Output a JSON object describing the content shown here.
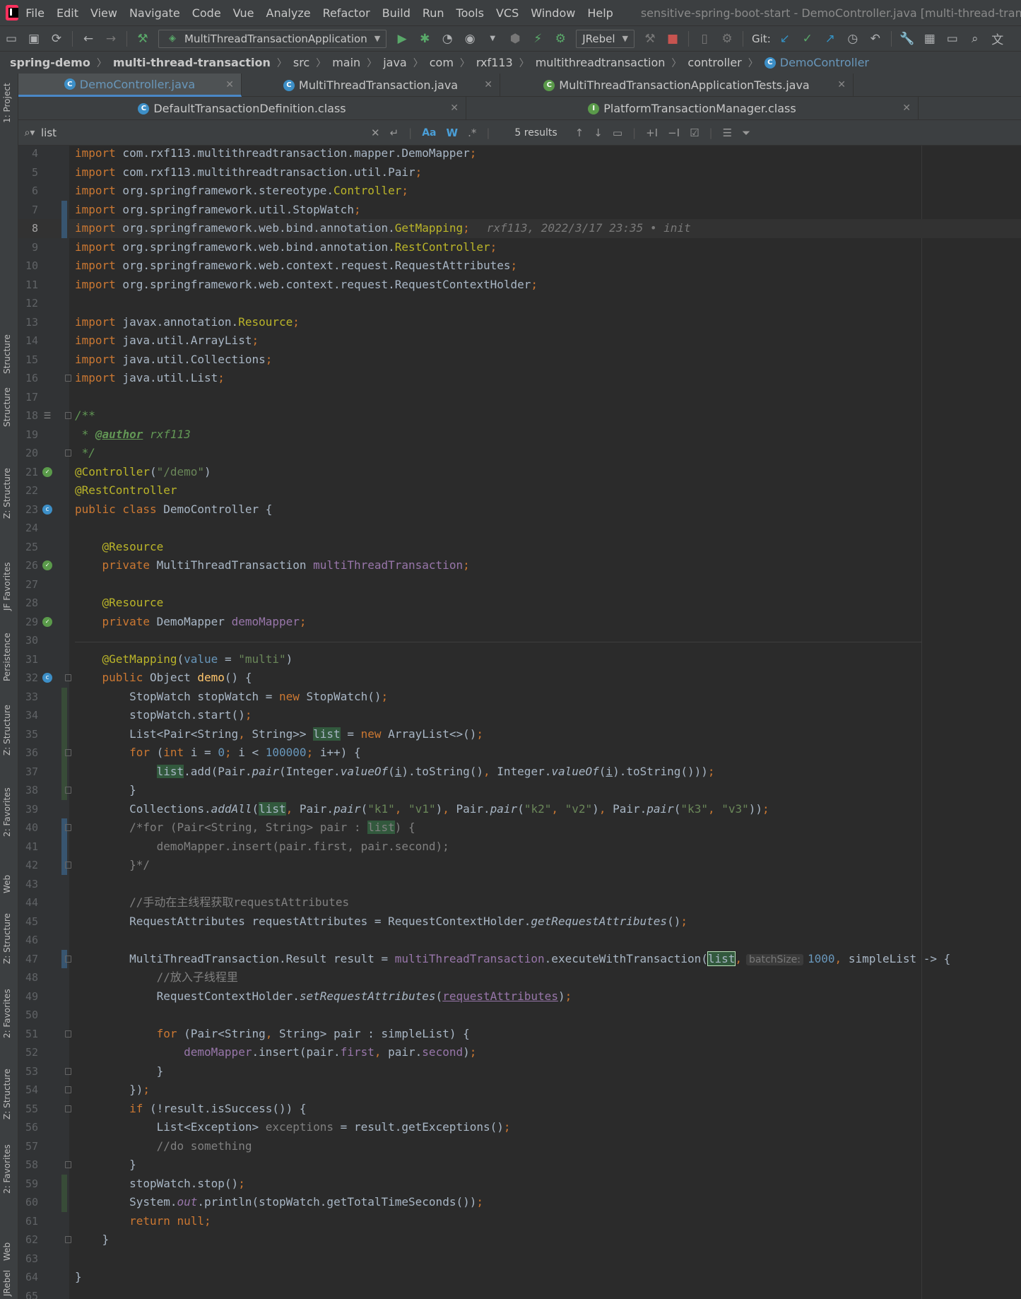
{
  "menu": {
    "items": [
      "File",
      "Edit",
      "View",
      "Navigate",
      "Code",
      "Vue",
      "Analyze",
      "Refactor",
      "Build",
      "Run",
      "Tools",
      "VCS",
      "Window",
      "Help"
    ],
    "window_title": "sensitive-spring-boot-start - DemoController.java [multi-thread-transaction] - Inte"
  },
  "toolbar": {
    "run_config": "MultiThreadTransactionApplication",
    "jrebel": "JRebel",
    "git_label": "Git:"
  },
  "breadcrumb": [
    "spring-demo",
    "multi-thread-transaction",
    "src",
    "main",
    "java",
    "com",
    "rxf113",
    "multithreadtransaction",
    "controller",
    "DemoController"
  ],
  "tabs_row1": [
    {
      "label": "DemoController.java",
      "active": true
    },
    {
      "label": "MultiThreadTransaction.java",
      "active": false
    },
    {
      "label": "MultiThreadTransactionApplicationTests.java",
      "active": false
    }
  ],
  "tabs_row2": [
    {
      "label": "DefaultTransactionDefinition.class"
    },
    {
      "label": "PlatformTransactionManager.class"
    }
  ],
  "search": {
    "value": "list",
    "results": "5 results",
    "match_case": "Aa",
    "words": "W"
  },
  "side_panels": [
    "1: Project",
    "Structure",
    "Structure",
    "Z: Structure",
    "JF Favorites",
    "Persistence",
    "Z: Structure",
    "2: Favorites",
    "Web",
    "Z: Structure",
    "2: Favorites",
    "Z: Structure",
    "2: Favorites",
    "Web",
    "JRebel"
  ],
  "editor": {
    "current_line": 8,
    "blame": "rxf113, 2022/3/17 23:35 • init",
    "hint_batch": "batchSize:",
    "line_numbers": [
      4,
      5,
      6,
      7,
      8,
      9,
      10,
      11,
      12,
      13,
      14,
      15,
      16,
      17,
      18,
      19,
      20,
      21,
      22,
      23,
      24,
      25,
      26,
      27,
      28,
      29,
      30,
      31,
      32,
      33,
      34,
      35,
      36,
      37,
      38,
      39,
      40,
      41,
      42,
      43,
      44,
      45,
      46,
      47,
      48,
      49,
      50,
      51,
      52,
      53,
      54,
      55,
      56,
      57,
      58,
      59,
      60,
      61,
      62,
      63,
      64,
      65
    ],
    "comment_main_thread": "//手动在主线程获取requestAttributes",
    "comment_sub_thread": "//放入子线程里",
    "comment_do": "//do something"
  }
}
